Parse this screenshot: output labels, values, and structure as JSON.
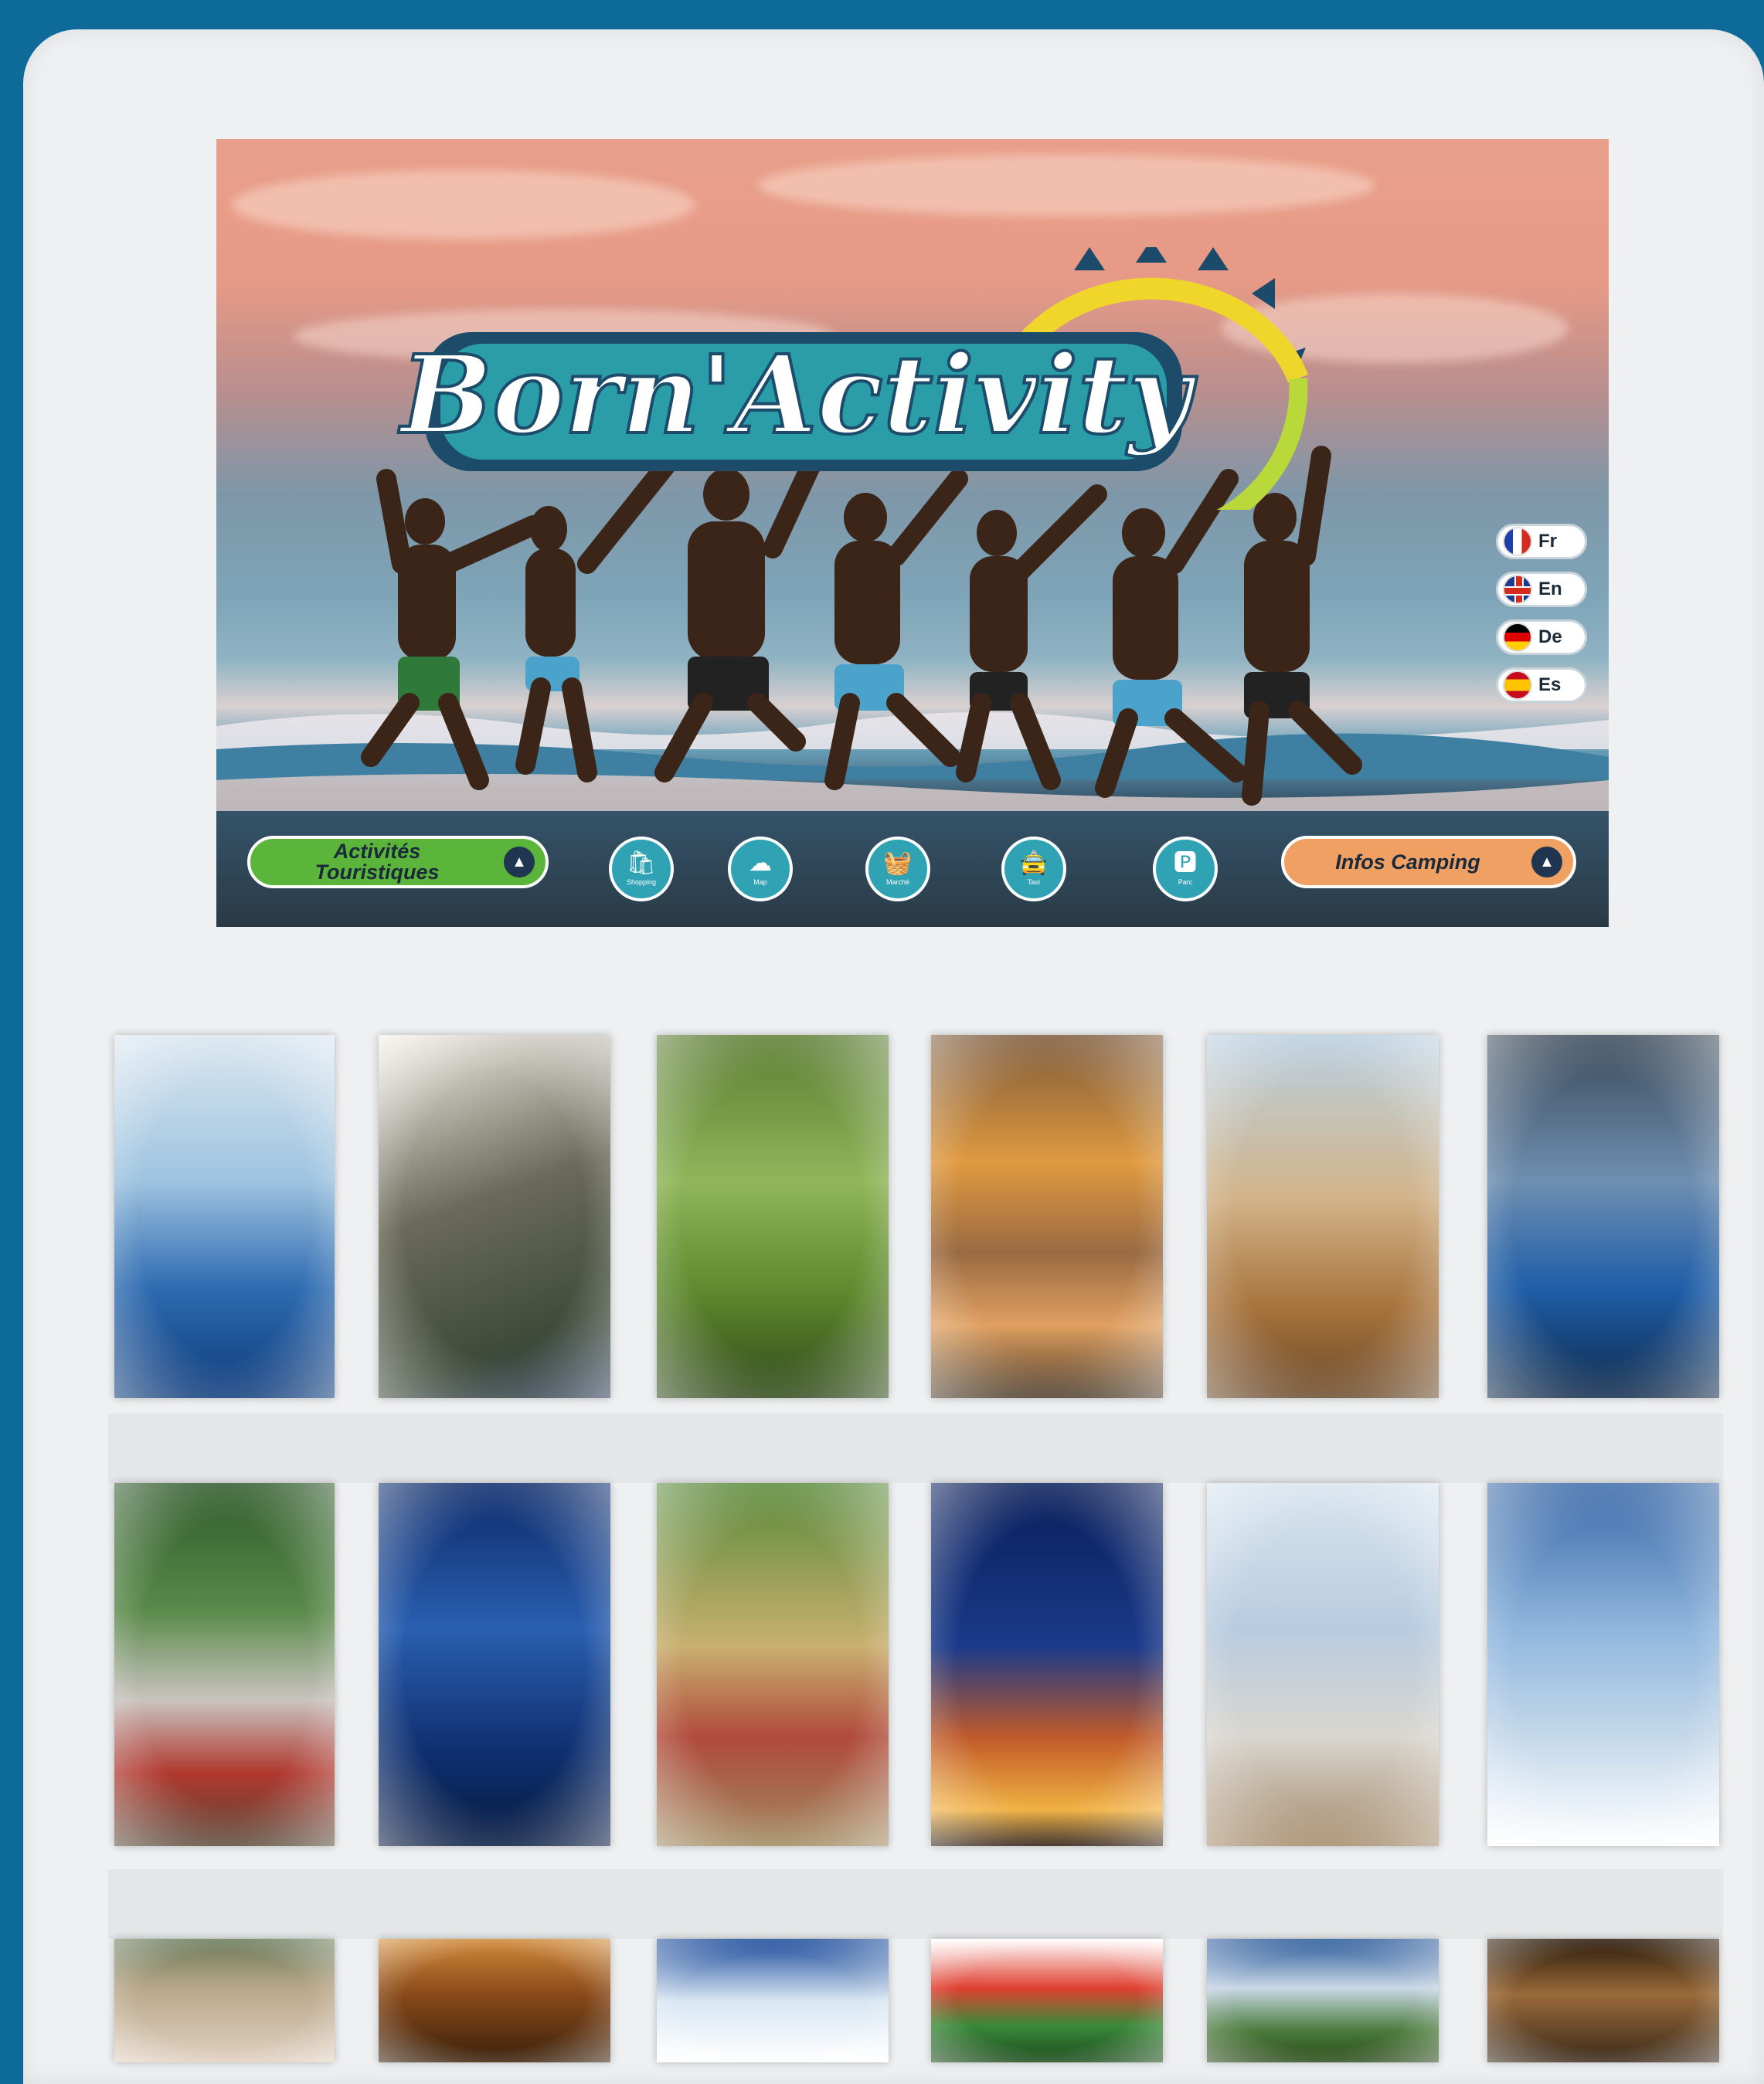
{
  "banner": {
    "logo_text": "Born'Activity",
    "languages": [
      {
        "code": "Fr",
        "flag": "france-flag-icon"
      },
      {
        "code": "En",
        "flag": "uk-flag-icon"
      },
      {
        "code": "De",
        "flag": "germany-flag-icon"
      },
      {
        "code": "Es",
        "flag": "spain-flag-icon"
      }
    ],
    "left_button": {
      "line1": "Activités",
      "line2": "Touristiques",
      "color": "#5bb53a"
    },
    "right_button": {
      "label": "Infos Camping",
      "color": "#f0a062"
    },
    "icon_buttons": [
      {
        "icon": "shopping-icon",
        "label": "Shopping"
      },
      {
        "icon": "map-icon",
        "label": "Map"
      },
      {
        "icon": "market-icon",
        "label": "Marché"
      },
      {
        "icon": "taxi-icon",
        "label": "Taxi"
      },
      {
        "icon": "parking-icon",
        "label": "Parc"
      }
    ]
  },
  "tiles": [
    {
      "name": "jet-ski-tile"
    },
    {
      "name": "paintball-tile"
    },
    {
      "name": "rope-bridge-tile"
    },
    {
      "name": "rafting-tile"
    },
    {
      "name": "quad-tile"
    },
    {
      "name": "vr-tile"
    },
    {
      "name": "amusement-tile"
    },
    {
      "name": "laser-tile"
    },
    {
      "name": "go-kart-tile"
    },
    {
      "name": "fairground-tile"
    },
    {
      "name": "horse-riding-tile"
    },
    {
      "name": "fishing-tile"
    },
    {
      "name": "animal-park-tile"
    },
    {
      "name": "cave-tile"
    },
    {
      "name": "beach-tile"
    },
    {
      "name": "dessert-tile"
    },
    {
      "name": "countryside-tile"
    },
    {
      "name": "wine-cellar-tile"
    }
  ],
  "colors": {
    "background": "#0e6a99",
    "panel": "#eef0f1",
    "icon_button": "#2fa2b4"
  }
}
